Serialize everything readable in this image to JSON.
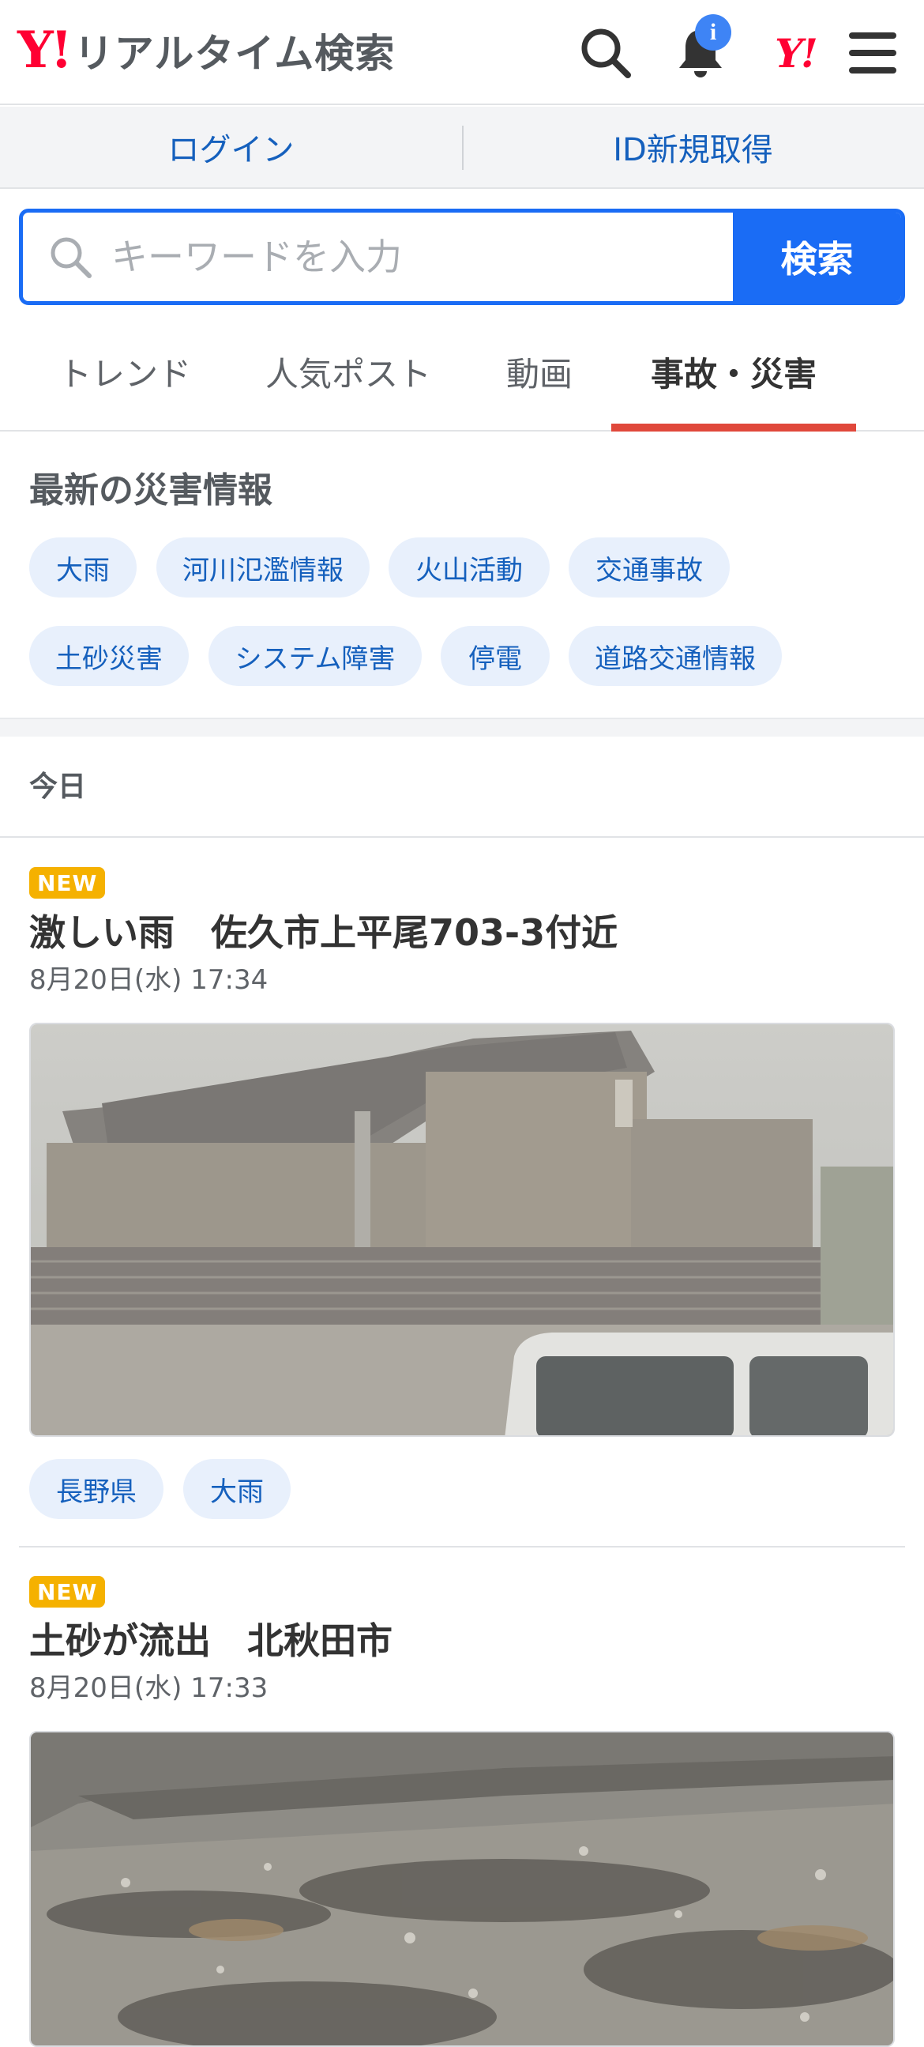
{
  "header": {
    "logo_mark": "Y!",
    "logo_text": "リアルタイム検索",
    "notification_badge": "i",
    "yj_mark": "Y!"
  },
  "login_bar": {
    "login_label": "ログイン",
    "register_label": "ID新規取得"
  },
  "search": {
    "placeholder": "キーワードを入力",
    "value": "",
    "button_label": "検索"
  },
  "tabs": [
    {
      "label": "トレンド"
    },
    {
      "label": "人気ポスト"
    },
    {
      "label": "動画"
    },
    {
      "label": "事故・災害",
      "active": true
    }
  ],
  "disaster": {
    "title": "最新の災害情報",
    "chips": [
      "大雨",
      "河川氾濫情報",
      "火山活動",
      "交通事故",
      "土砂災害",
      "システム障害",
      "停電",
      "道路交通情報"
    ]
  },
  "today_label": "今日",
  "articles": [
    {
      "badge": "NEW",
      "title": "激しい雨　佐久市上平尾703-3付近",
      "date": "8月20日(水) 17:34",
      "tags": [
        "長野県",
        "大雨"
      ]
    },
    {
      "badge": "NEW",
      "title": "土砂が流出　北秋田市",
      "date": "8月20日(水) 17:33",
      "tags": []
    }
  ],
  "colors": {
    "brand_red": "#ff0033",
    "accent_blue": "#1a6cf5",
    "link_blue": "#1560bd",
    "tab_underline": "#e0483b",
    "new_badge": "#f5b100",
    "chip_bg": "#e8f0fc"
  }
}
